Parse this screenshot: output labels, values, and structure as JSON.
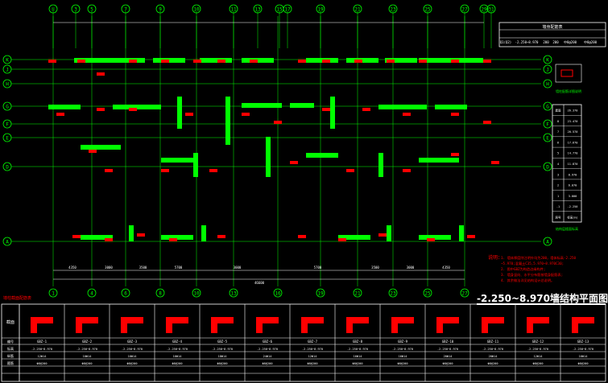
{
  "drawing": {
    "title": "-2.250~8.970墙结构平面图",
    "col_axes_top": [
      "①",
      "3",
      "5",
      "7",
      "9",
      "10",
      "11",
      "13",
      "15",
      "17",
      "19",
      "21",
      "23",
      "25",
      "27",
      "29",
      "31"
    ],
    "col_axes_bottom": [
      "1",
      "4",
      "6",
      "8",
      "10",
      "13",
      "16",
      "19",
      "21",
      "23",
      "25",
      "27"
    ],
    "row_axes": [
      "K",
      "J",
      "H",
      "G",
      "F",
      "E",
      "D",
      "A"
    ],
    "bottom_dims": [
      "4350",
      "3000",
      "3500",
      "5700",
      "3000",
      "5700",
      "3500",
      "3000",
      "4350"
    ],
    "overall_dim": "46600"
  },
  "top_table": {
    "header": "墙身配筋表",
    "row": [
      "Q1(Q2)",
      "-2.250~8.970",
      "200",
      "200",
      "中8@200",
      "中8@200"
    ]
  },
  "floor_table": {
    "caption": "结构层楼面标高",
    "rows": [
      [
        "屋面",
        "26.370"
      ],
      [
        "8",
        "23.470"
      ],
      [
        "7",
        "20.570"
      ],
      [
        "6",
        "17.670"
      ],
      [
        "5",
        "14.770"
      ],
      [
        "4",
        "11.870"
      ],
      [
        "3",
        "8.970"
      ],
      [
        "2",
        "6.070"
      ],
      [
        "1",
        "3.000"
      ],
      [
        "-1",
        "-2.250"
      ]
    ],
    "footer": [
      "层号",
      "标高(m)"
    ]
  },
  "notes": {
    "label": "说明：",
    "lines": [
      "1. 墙体厚度除注明外均为200，墙体标高-2.250",
      "~5.970;混凝土C35,5.970~8.970C30;",
      "2. 图中GBZ为构造边缘构件;",
      "3. 墙身竖向、水平分布筋按墙身配筋表;",
      "4. 其余做法详见结构设计总说明。"
    ]
  },
  "legend_caption": "墙柱配筋详图说明",
  "bottom_table": {
    "left_label": "截面",
    "row_labels": [
      "编号",
      "标高",
      "纵筋",
      "箍筋"
    ],
    "columns": [
      {
        "id": "GBZ-1",
        "elev": "-2.250~8.970",
        "bars": "12Φ14",
        "stir": "Φ8@200"
      },
      {
        "id": "GBZ-2",
        "elev": "-2.250~8.970",
        "bars": "10Φ14",
        "stir": "Φ8@200"
      },
      {
        "id": "GBZ-3",
        "elev": "-2.250~8.970",
        "bars": "16Φ14",
        "stir": "Φ8@200"
      },
      {
        "id": "GBZ-4",
        "elev": "-2.250~8.970",
        "bars": "16Φ14",
        "stir": "Φ8@200"
      },
      {
        "id": "GBZ-5",
        "elev": "-2.250~8.970",
        "bars": "18Φ14",
        "stir": "Φ8@200"
      },
      {
        "id": "GBZ-6",
        "elev": "-2.250~8.970",
        "bars": "24Φ14",
        "stir": "Φ8@200"
      },
      {
        "id": "GBZ-7",
        "elev": "-2.250~8.970",
        "bars": "12Φ14",
        "stir": "Φ8@200"
      },
      {
        "id": "GBZ-8",
        "elev": "-2.250~8.970",
        "bars": "16Φ14",
        "stir": "Φ8@200"
      },
      {
        "id": "GBZ-9",
        "elev": "-2.250~8.970",
        "bars": "16Φ14",
        "stir": "Φ8@200"
      },
      {
        "id": "GBZ-10",
        "elev": "-2.250~8.970",
        "bars": "20Φ14",
        "stir": "Φ8@200"
      },
      {
        "id": "GBZ-11",
        "elev": "-2.250~8.970",
        "bars": "20Φ14",
        "stir": "Φ8@200"
      },
      {
        "id": "GBZ-12",
        "elev": "-2.250~8.970",
        "bars": "12Φ14",
        "stir": "Φ8@200"
      },
      {
        "id": "GBZ-13",
        "elev": "-2.250~8.970",
        "bars": "16Φ14",
        "stir": "Φ8@200"
      }
    ]
  },
  "colors": {
    "background": "#000000",
    "axis": "#00ff00",
    "wall": "#00ff00",
    "column": "#ff0000",
    "label": "#ffff00",
    "dim": "#ffffff",
    "bubble": "#00ffff"
  }
}
